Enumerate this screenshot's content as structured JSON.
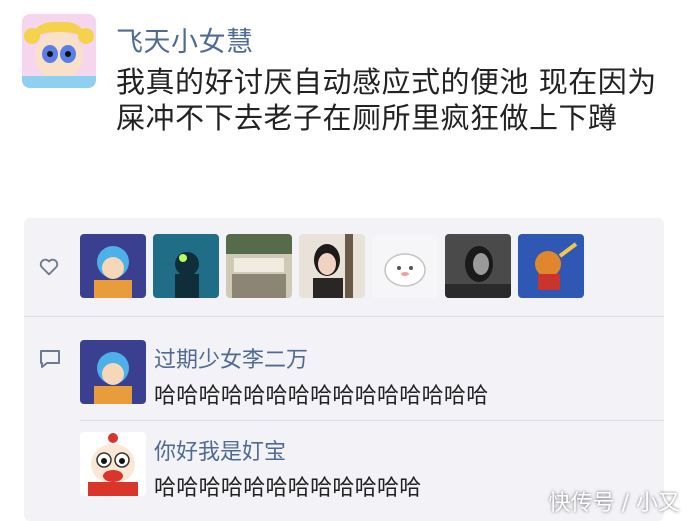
{
  "post": {
    "author": "飞天小女慧",
    "text": "我真的好讨厌自动感应式的便池 现在因为屎冲不下去老子在厕所里疯狂做上下蹲"
  },
  "likes": {
    "icon": "heart-icon",
    "avatars": [
      "liker-avatar-1",
      "liker-avatar-2",
      "liker-avatar-3",
      "liker-avatar-4",
      "liker-avatar-5",
      "liker-avatar-6",
      "liker-avatar-7"
    ]
  },
  "comments": {
    "icon": "comment-icon",
    "items": [
      {
        "name": "过期少女李二万",
        "text": "哈哈哈哈哈哈哈哈哈哈哈哈哈哈哈"
      },
      {
        "name": "你好我是奵宝",
        "text": "哈哈哈哈哈哈哈哈哈哈哈哈"
      }
    ]
  },
  "watermark": "快传号 / 小又",
  "colors": {
    "name": "#4f6b94",
    "panel": "#f3f2f7"
  }
}
